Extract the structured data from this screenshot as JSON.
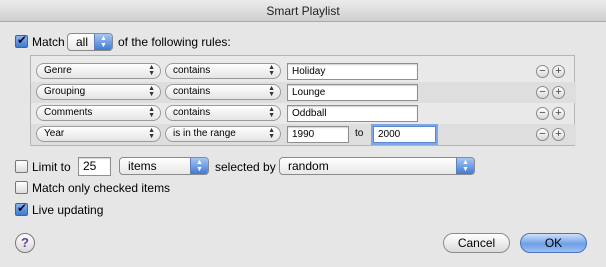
{
  "window": {
    "title": "Smart Playlist"
  },
  "match": {
    "checkbox_label": "Match",
    "checked": true,
    "mode": "all",
    "suffix": "of the following rules:"
  },
  "rules": [
    {
      "field": "Genre",
      "operator": "contains",
      "value": "Holiday"
    },
    {
      "field": "Grouping",
      "operator": "contains",
      "value": "Lounge"
    },
    {
      "field": "Comments",
      "operator": "contains",
      "value": "Oddball"
    },
    {
      "field": "Year",
      "operator": "is in the range",
      "value": "1990",
      "to_label": "to",
      "value2": "2000"
    }
  ],
  "rule_buttons": {
    "remove": "−",
    "add": "+"
  },
  "limit": {
    "checkbox_label": "Limit to",
    "checked": false,
    "amount": "25",
    "unit": "items",
    "selected_by_label": "selected by",
    "selected_by": "random"
  },
  "match_checked": {
    "label": "Match only checked items",
    "checked": false
  },
  "live_updating": {
    "label": "Live updating",
    "checked": true
  },
  "buttons": {
    "help": "?",
    "cancel": "Cancel",
    "ok": "OK"
  },
  "colors": {
    "accent": "#3c78d0",
    "default_button": "#6f9fe6"
  }
}
